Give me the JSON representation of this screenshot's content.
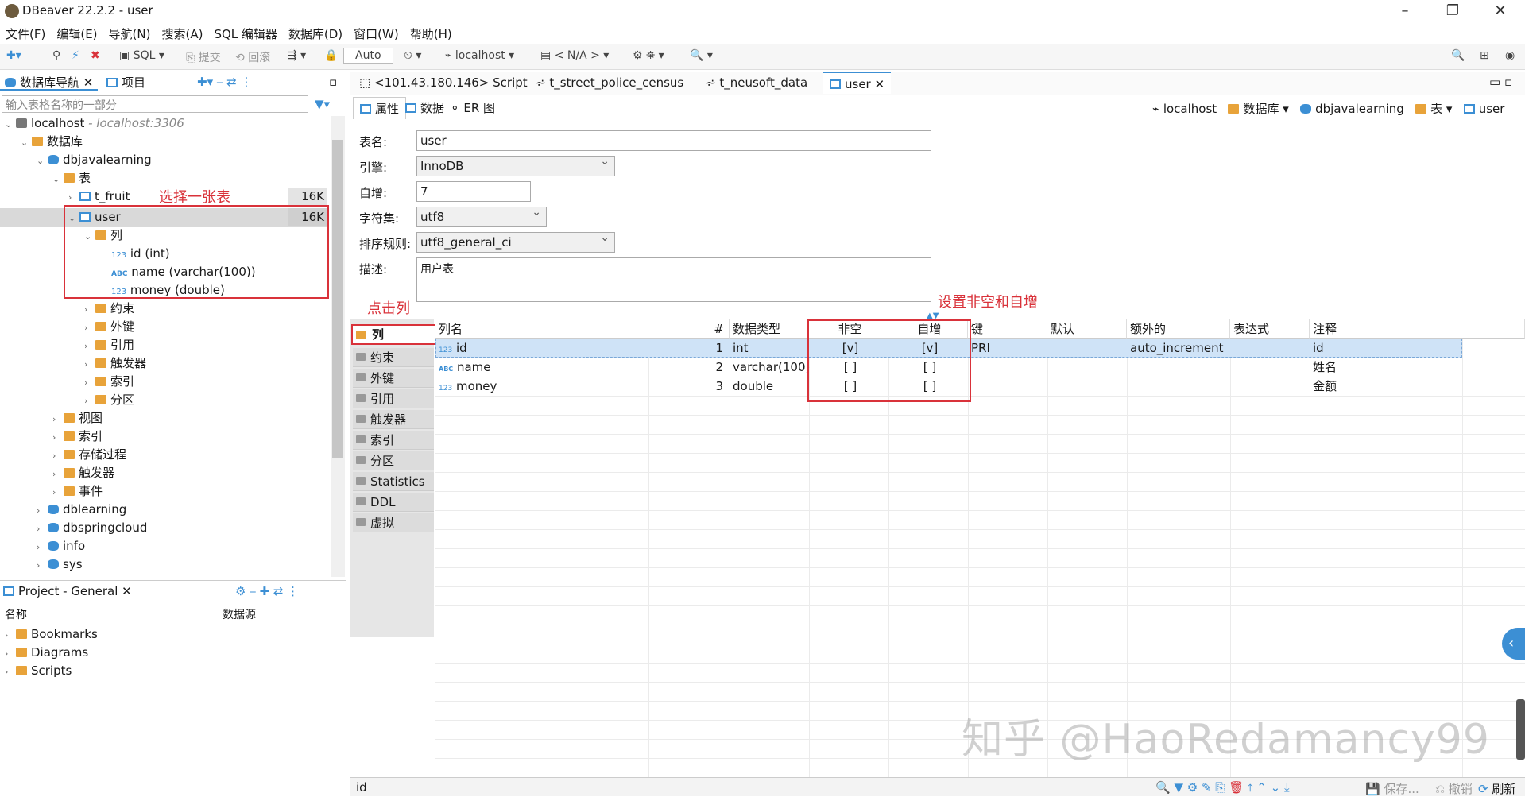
{
  "window": {
    "title": "DBeaver 22.2.2 - user"
  },
  "menu": [
    "文件(F)",
    "编辑(E)",
    "导航(N)",
    "搜索(A)",
    "SQL 编辑器",
    "数据库(D)",
    "窗口(W)",
    "帮助(H)"
  ],
  "toolbar": {
    "sql": "SQL",
    "commit": "提交",
    "rollback": "回滚",
    "tx_mode": "Auto",
    "connection": "localhost",
    "schema": "< N/A >"
  },
  "nav_panel": {
    "tab_db": "数据库导航",
    "tab_project": "项目",
    "filter_placeholder": "输入表格名称的一部分",
    "tree": [
      {
        "label": "localhost",
        "sub": " - localhost:3306"
      },
      {
        "label": "数据库"
      },
      {
        "label": "dbjavalearning"
      },
      {
        "label": "表"
      },
      {
        "label": "t_fruit",
        "size": "16K"
      },
      {
        "label": "user",
        "size": "16K"
      },
      {
        "label": "列"
      },
      {
        "label": "id (int)"
      },
      {
        "label": "name (varchar(100))"
      },
      {
        "label": "money (double)"
      },
      {
        "label": "约束"
      },
      {
        "label": "外键"
      },
      {
        "label": "引用"
      },
      {
        "label": "触发器"
      },
      {
        "label": "索引"
      },
      {
        "label": "分区"
      },
      {
        "label": "视图"
      },
      {
        "label": "索引"
      },
      {
        "label": "存储过程"
      },
      {
        "label": "触发器"
      },
      {
        "label": "事件"
      },
      {
        "label": "dblearning"
      },
      {
        "label": "dbspringcloud"
      },
      {
        "label": "info"
      },
      {
        "label": "sys"
      }
    ],
    "annotation_select": "选择一张表"
  },
  "project_panel": {
    "title": "Project - General",
    "col_name": "名称",
    "col_source": "数据源",
    "items": [
      "Bookmarks",
      "Diagrams",
      "Scripts"
    ]
  },
  "editor_tabs": [
    "<101.43.180.146> Script",
    "t_street_police_census",
    "t_neusoft_data",
    "user"
  ],
  "sub_tabs": [
    "属性",
    "数据",
    "ER 图"
  ],
  "breadcrumb": [
    "localhost",
    "数据库",
    "dbjavalearning",
    "表",
    "user"
  ],
  "form": {
    "name_label": "表名:",
    "name_value": "user",
    "engine_label": "引擎:",
    "engine_value": "InnoDB",
    "autoinc_label": "自增:",
    "autoinc_value": "7",
    "charset_label": "字符集:",
    "charset_value": "utf8",
    "collation_label": "排序规则:",
    "collation_value": "utf8_general_ci",
    "desc_label": "描述:",
    "desc_value": "用户表"
  },
  "annotations": {
    "click_columns": "点击列",
    "set_notnull": "设置非空和自增"
  },
  "side_nav": [
    "列",
    "约束",
    "外键",
    "引用",
    "触发器",
    "索引",
    "分区",
    "Statistics",
    "DDL",
    "虚拟"
  ],
  "grid": {
    "headers": [
      "列名",
      "#",
      "数据类型",
      "非空",
      "自增",
      "键",
      "默认",
      "额外的",
      "表达式",
      "注释"
    ],
    "rows": [
      {
        "name": "id",
        "num": "1",
        "type": "int",
        "notnull": "[v]",
        "autoinc": "[v]",
        "key": "PRI",
        "default": "",
        "extra": "auto_increment",
        "expr": "",
        "comment": "id"
      },
      {
        "name": "name",
        "num": "2",
        "type": "varchar(100)",
        "notnull": "[ ]",
        "autoinc": "[ ]",
        "key": "",
        "default": "",
        "extra": "",
        "expr": "",
        "comment": "姓名"
      },
      {
        "name": "money",
        "num": "3",
        "type": "double",
        "notnull": "[ ]",
        "autoinc": "[ ]",
        "key": "",
        "default": "",
        "extra": "",
        "expr": "",
        "comment": "金额"
      }
    ]
  },
  "status": {
    "left": "id",
    "save": "保存...",
    "cancel": "撤销",
    "refresh": "刷新"
  },
  "watermark": "知乎 @HaoRedamancy99",
  "colors": {
    "accent": "#3c8fd4",
    "annotation_red": "#d9323a",
    "selected_row": "#cfe3f7"
  }
}
